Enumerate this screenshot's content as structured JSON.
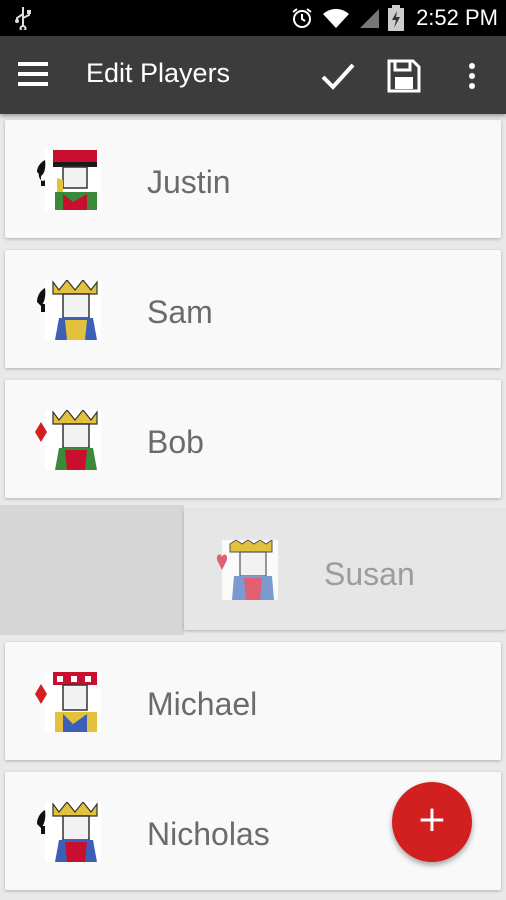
{
  "status_bar": {
    "time": "2:52 PM",
    "icons": [
      "usb-icon",
      "alarm-icon",
      "wifi-icon",
      "signal-icon",
      "battery-charging-icon"
    ]
  },
  "toolbar": {
    "title": "Edit Players",
    "menu_icon": "hamburger-menu-icon",
    "actions": [
      "check-icon",
      "save-icon",
      "overflow-menu-icon"
    ]
  },
  "players": [
    {
      "name": "Justin",
      "card_icon": "jack-of-spades-icon"
    },
    {
      "name": "Sam",
      "card_icon": "king-of-spades-icon"
    },
    {
      "name": "Bob",
      "card_icon": "king-of-diamonds-icon"
    },
    {
      "name": "Susan",
      "card_icon": "queen-of-hearts-icon",
      "state": "dragging"
    },
    {
      "name": "Michael",
      "card_icon": "jack-of-diamonds-icon"
    },
    {
      "name": "Nicholas",
      "card_icon": "king-of-spades-icon"
    }
  ],
  "fab": {
    "label": "+",
    "icon": "add-icon"
  },
  "colors": {
    "toolbar": "#3c3c3c",
    "status_bar": "#000000",
    "fab": "#d21f1f",
    "card": "#f9f9f9",
    "background": "#e9e9e9",
    "name_text": "#6b6b6b"
  }
}
